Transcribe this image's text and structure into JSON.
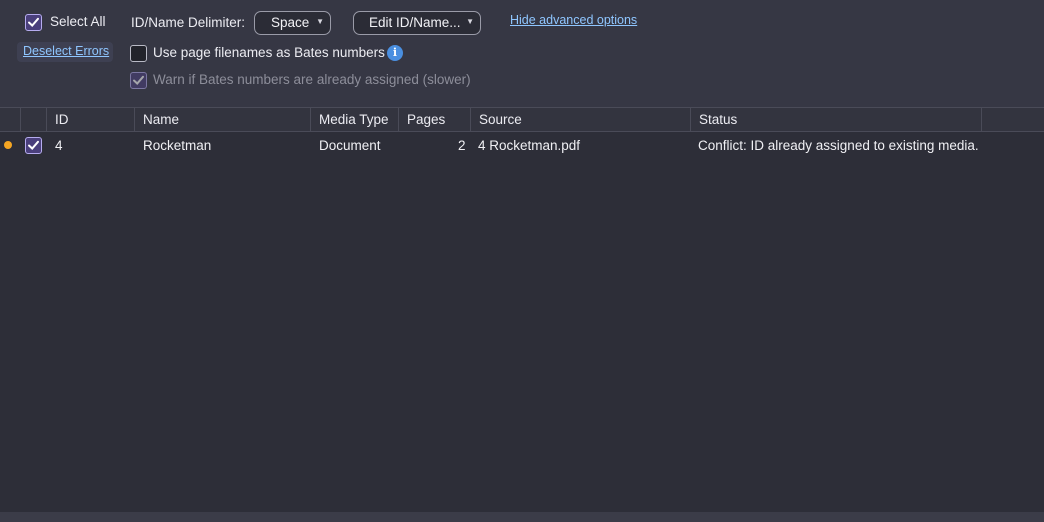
{
  "toolbar": {
    "select_all_label": "Select All",
    "select_all_checked": true,
    "deselect_errors_label": "Deselect Errors",
    "delimiter_label": "ID/Name Delimiter:",
    "delimiter_value": "Space",
    "edit_id_name_label": "Edit ID/Name...",
    "hide_advanced_label": "Hide advanced options",
    "use_page_filenames_label": "Use page filenames as Bates numbers",
    "use_page_filenames_checked": false,
    "warn_bates_label": "Warn if Bates numbers are already assigned (slower)",
    "warn_bates_checked": true,
    "warn_bates_disabled": true
  },
  "table": {
    "columns": [
      "ID",
      "Name",
      "Media Type",
      "Pages",
      "Source",
      "Status"
    ],
    "rows": [
      {
        "status_color": "#f5a623",
        "checked": true,
        "id": "4",
        "name": "Rocketman",
        "media_type": "Document",
        "pages": "2",
        "source": "4 Rocketman.pdf",
        "status": "Conflict: ID already assigned to existing media."
      }
    ]
  },
  "colors": {
    "background": "#2d2e38",
    "toolbar": "#363744",
    "link": "#8fc6ff",
    "checkbox_checked": "#4a3f7c",
    "info": "#4a8fe0",
    "warning_dot": "#f5a623"
  }
}
